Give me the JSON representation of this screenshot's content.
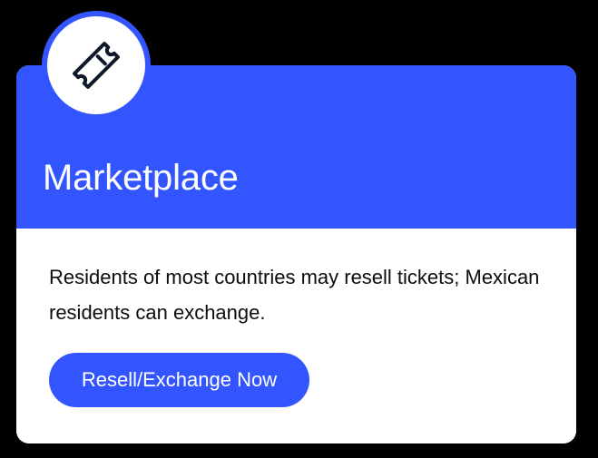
{
  "card": {
    "icon": "ticket-icon",
    "title": "Marketplace",
    "description": "Residents of most countries may resell tickets; Mexican residents can exchange.",
    "button_label": "Resell/Exchange Now"
  },
  "colors": {
    "page_background": "#000000",
    "accent": "#3355ff",
    "card_background": "#ffffff",
    "text": "#0d0d0d",
    "icon_stroke": "#0f172a"
  }
}
